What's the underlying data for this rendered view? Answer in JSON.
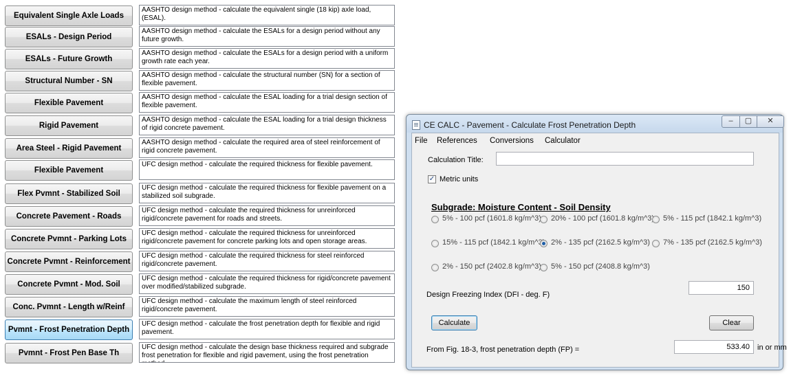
{
  "menu": {
    "items": [
      {
        "label": "Equivalent Single Axle Loads",
        "desc": "AASHTO design method - calculate the equivalent single (18 kip) axle load, (ESAL)."
      },
      {
        "label": "ESALs - Design Period",
        "desc": "AASHTO design method - calculate the ESALs for a design period without any future growth."
      },
      {
        "label": "ESALs - Future Growth",
        "desc": "AASHTO design method - calculate the ESALs for a design period with a uniform growth rate each year."
      },
      {
        "label": "Structural Number - SN",
        "desc": "AASHTO design method - calculate the structural number (SN) for a section of flexible pavement."
      },
      {
        "label": "Flexible Pavement",
        "desc": "AASHTO design method - calculate the ESAL loading for a trial design section of flexible pavement."
      },
      {
        "label": "Rigid Pavement",
        "desc": "AASHTO design method - calculate the ESAL loading for a trial design thickness of rigid concrete pavement."
      },
      {
        "label": "Area Steel - Rigid Pavement",
        "desc": "AASHTO design method - calculate the required area of steel reinforcement of rigid concrete pavement."
      },
      {
        "label": "Flexible Pavement",
        "desc": "UFC design method - calculate the required thickness for flexible pavement."
      },
      {
        "label": "Flex Pvmnt - Stabilized Soil",
        "desc": "UFC design method - calculate the required thickness for flexible pavement on a stabilized soil subgrade."
      },
      {
        "label": "Concrete Pavement - Roads",
        "desc": "UFC design method - calculate the required thickness for unreinforced rigid/concrete pavement for roads and streets."
      },
      {
        "label": "Concrete Pvmnt - Parking Lots",
        "desc": "UFC design method - calculate the required thickness for unreinforced rigid/concrete pavement for concrete parking lots and open storage areas."
      },
      {
        "label": "Concrete Pvmnt - Reinforcement",
        "desc": "UFC design method - calculate the required thickness for steel reinforced rigid/concrete pavement."
      },
      {
        "label": "Concrete Pvmnt - Mod. Soil",
        "desc": "UFC design method - calculate the required thickness for rigid/concrete pavement over modified/stabilized subgrade."
      },
      {
        "label": "Conc. Pvmnt - Length w/Reinf",
        "desc": "UFC design method - calculate the maximum length of steel reinforced rigid/concrete pavement."
      },
      {
        "label": "Pvmnt - Frost Penetration Depth",
        "desc": "UFC design method - calculate the frost penetration depth for flexible and rigid pavement."
      },
      {
        "label": "Pvmnt - Frost Pen Base Th",
        "desc": "UFC design method - calculate the design base thickness required and subgrade frost penetration for flexible and rigid pavement, using the frost penetration method."
      }
    ],
    "active_index": 14
  },
  "dialog": {
    "title": "CE CALC - Pavement - Calculate Frost Penetration Depth",
    "window_controls": {
      "minimize": "–",
      "maximize": "▢",
      "close": "✕"
    },
    "menubar": [
      "File",
      "References",
      "Conversions",
      "Calculator"
    ],
    "calc_title_label": "Calculation Title:",
    "calc_title_value": "",
    "metric_label": "Metric units",
    "metric_checked": true,
    "section_title": "Subgrade: Moisture Content - Soil Density",
    "radio_options": [
      "5% - 100 pcf (1601.8 kg/m^3)",
      "20% - 100 pcf (1601.8 kg/m^3)",
      "5% - 115 pcf (1842.1 kg/m^3)",
      "15% - 115 pcf (1842.1 kg/m^3)",
      "2% - 135 pcf (2162.5 kg/m^3)",
      "7% - 135 pcf (2162.5 kg/m^3)",
      "2% - 150 pcf (2402.8 kg/m^3)",
      "5% - 150 pcf (2408.8 kg/m^3)"
    ],
    "selected_radio": 4,
    "dfi_label": "Design Freezing Index (DFI - deg. F)",
    "dfi_value": "150",
    "calculate_label": "Calculate",
    "clear_label": "Clear",
    "result_label": "From Fig. 18-3, frost penetration depth (FP) =",
    "result_value": "533.40",
    "result_unit": "in or mm"
  }
}
